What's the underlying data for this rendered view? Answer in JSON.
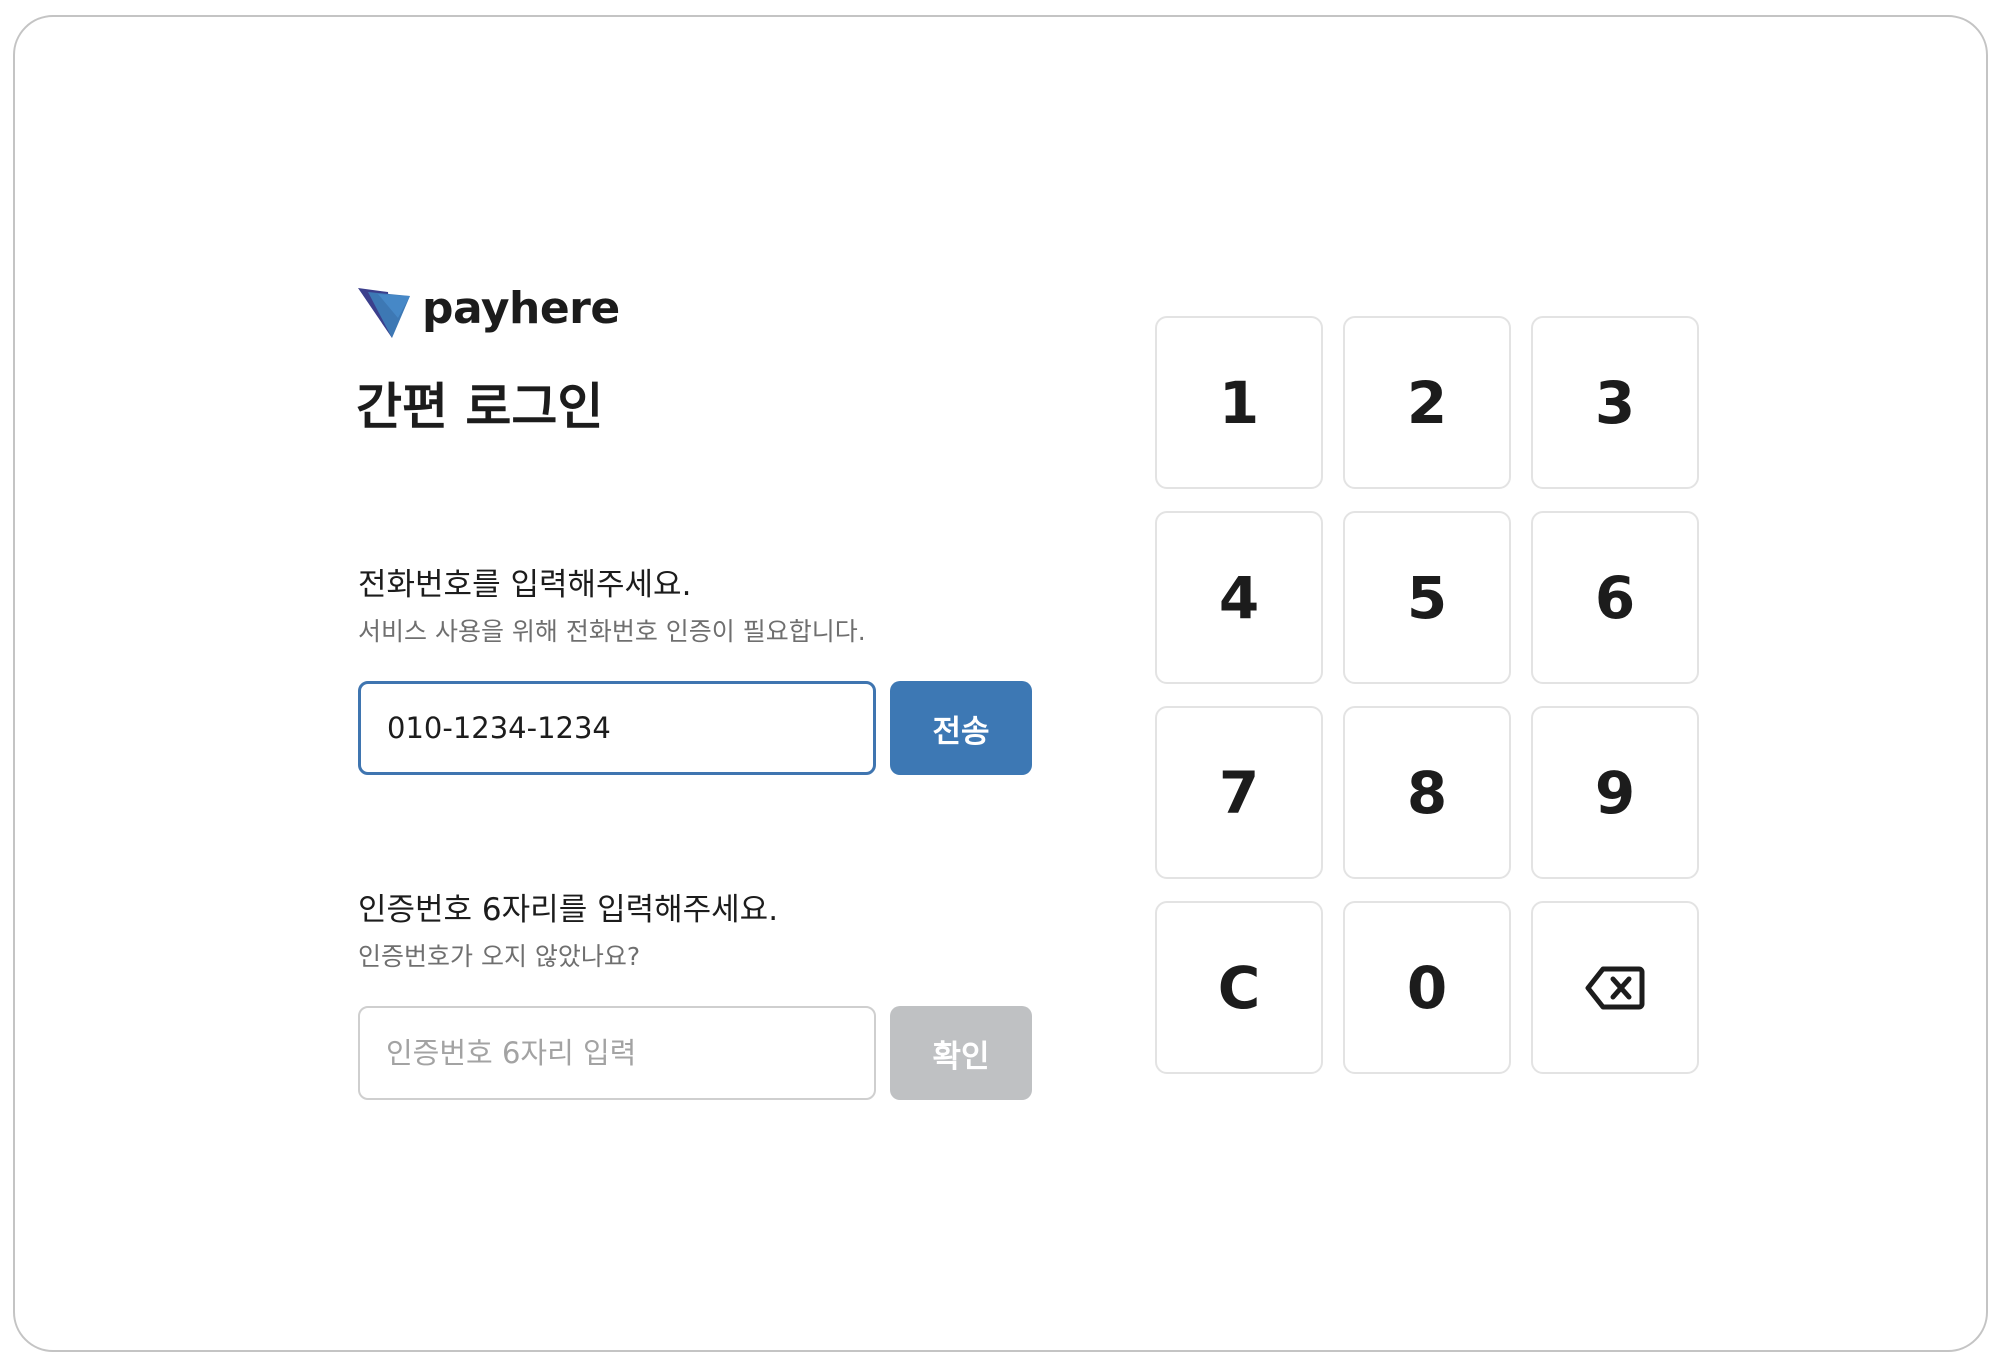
{
  "brand": {
    "name": "payhere",
    "accent": "#3d78b4"
  },
  "page": {
    "title": "간편 로그인"
  },
  "phone": {
    "label": "전화번호를 입력해주세요.",
    "help": "서비스 사용을 위해 전화번호 인증이 필요합니다.",
    "value": "010-1234-1234",
    "send_label": "전송"
  },
  "code": {
    "label": "인증번호 6자리를 입력해주세요.",
    "help": "인증번호가 오지 않았나요?",
    "placeholder": "인증번호 6자리 입력",
    "value": "",
    "confirm_label": "확인",
    "confirm_color": "#bfc1c3"
  },
  "keypad": {
    "keys": [
      "1",
      "2",
      "3",
      "4",
      "5",
      "6",
      "7",
      "8",
      "9",
      "C",
      "0"
    ],
    "backspace_icon": "backspace-icon"
  }
}
